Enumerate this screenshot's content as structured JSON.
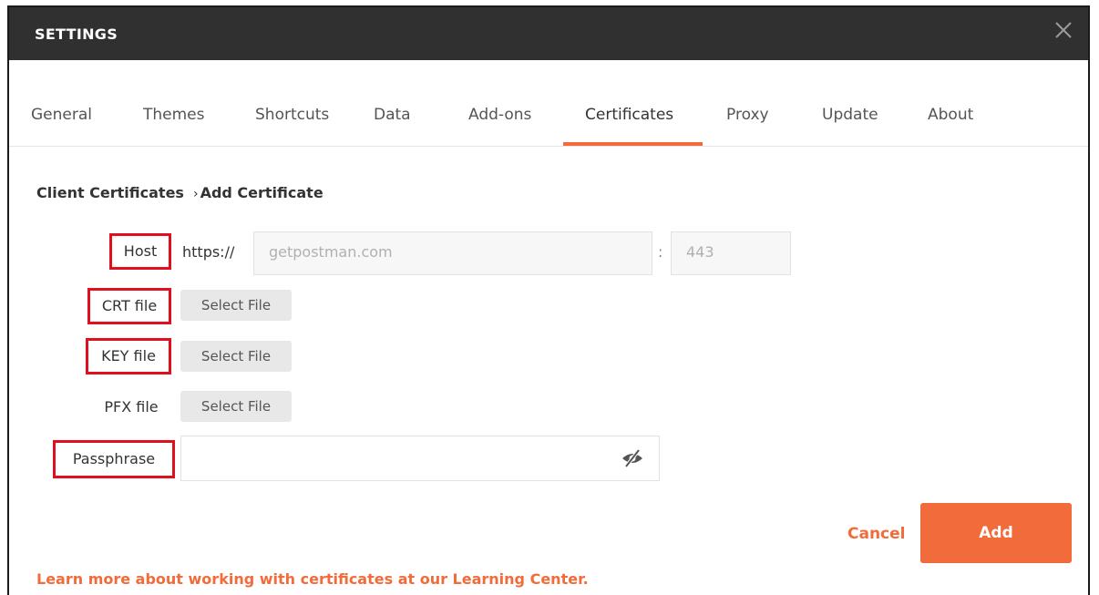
{
  "header": {
    "title": "SETTINGS"
  },
  "tabs": [
    {
      "label": "General"
    },
    {
      "label": "Themes"
    },
    {
      "label": "Shortcuts"
    },
    {
      "label": "Data"
    },
    {
      "label": "Add-ons"
    },
    {
      "label": "Certificates"
    },
    {
      "label": "Proxy"
    },
    {
      "label": "Update"
    },
    {
      "label": "About"
    }
  ],
  "active_tab": "Certificates",
  "breadcrumb": {
    "parent": "Client Certificates",
    "current": "Add Certificate"
  },
  "form": {
    "host_label": "Host",
    "host_prefix": "https://",
    "host_placeholder": "getpostman.com",
    "port_separator": ":",
    "port_placeholder": "443",
    "crt_label": "CRT file",
    "key_label": "KEY file",
    "pfx_label": "PFX file",
    "select_file_label": "Select File",
    "passphrase_label": "Passphrase",
    "passphrase_value": ""
  },
  "actions": {
    "cancel_label": "Cancel",
    "add_label": "Add"
  },
  "footer": {
    "learn_more": "Learn more about working with certificates at our Learning Center."
  },
  "colors": {
    "accent": "#f26b3a",
    "header_bg": "#303030",
    "highlight_box": "#e0101e"
  },
  "icons": {
    "close": "close-icon",
    "eye_hidden": "eye-slash-icon"
  }
}
